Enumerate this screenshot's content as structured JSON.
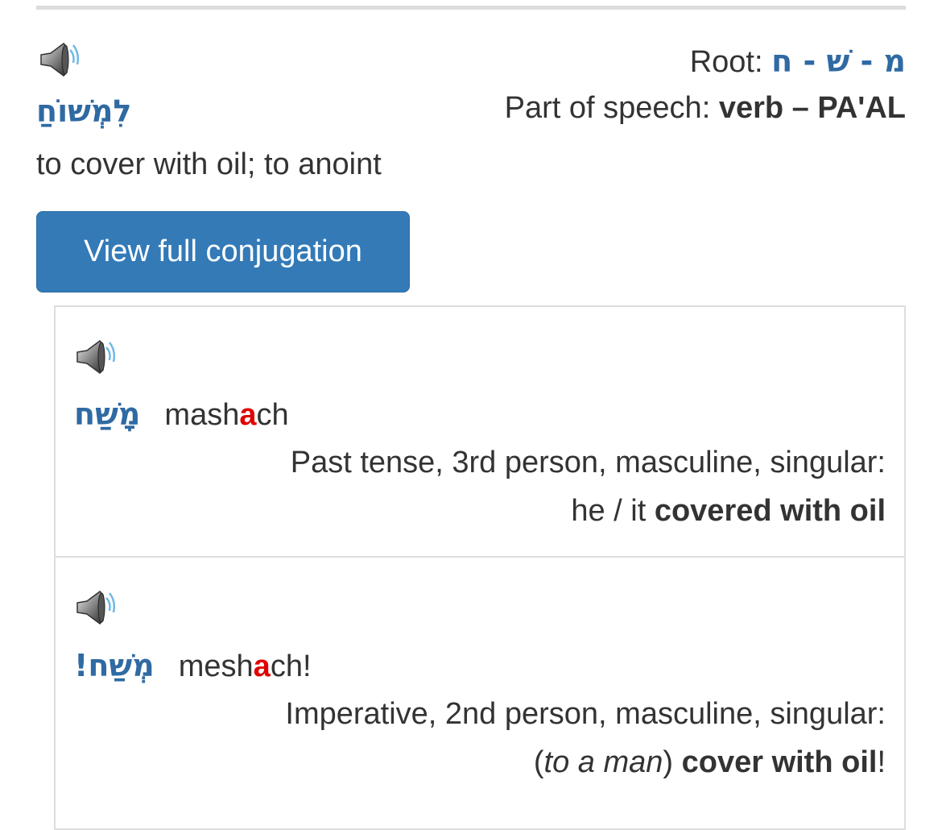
{
  "header": {
    "word": "לִמְשׁוֹחַ",
    "meaning": "to cover with oil; to anoint",
    "root_label": "Root:",
    "root": "מ - שׁ - ח",
    "pos_label": "Part of speech:",
    "pos_value": "verb – PA'AL",
    "speaker_icon": "speaker-icon"
  },
  "button": {
    "label": "View full conjugation",
    "color": "#337ab7"
  },
  "forms": [
    {
      "hebrew": "מָשַׁח",
      "translit_pre": "mash",
      "translit_stress": "a",
      "translit_post": "ch",
      "description": "Past tense, 3rd person, masculine, singular:",
      "trans_pre": "he / it",
      "trans_italic": "",
      "trans_bold": "covered with oil",
      "trans_post": ""
    },
    {
      "hebrew": "מְשַׁח!",
      "translit_pre": "mesh",
      "translit_stress": "a",
      "translit_post": "ch!",
      "description": "Imperative, 2nd person, masculine, singular:",
      "trans_open": "(",
      "trans_italic": "to a man",
      "trans_close": ")",
      "trans_bold": "cover with oil",
      "trans_post": "!"
    }
  ],
  "colors": {
    "hebrew": "#2f6aa3",
    "stress": "#e10000",
    "text": "#333333"
  }
}
